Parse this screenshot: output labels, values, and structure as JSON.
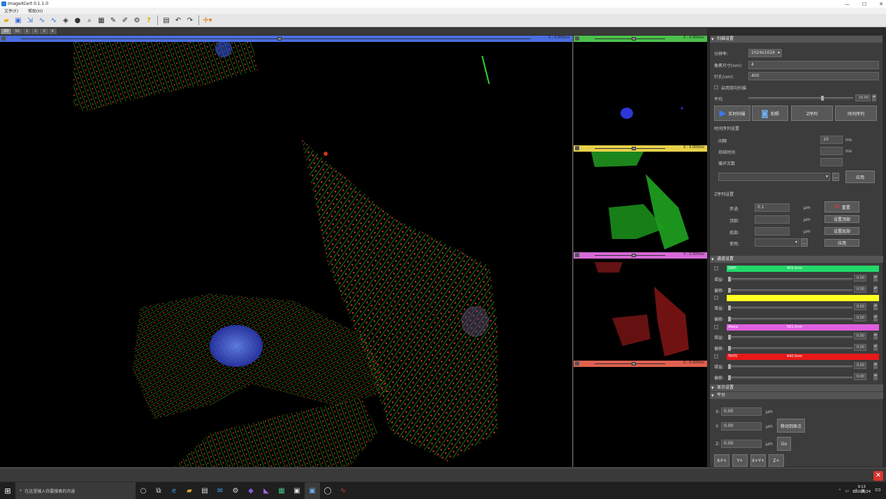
{
  "window": {
    "title": "ImageXCert 0.1.1.0",
    "minimize": "—",
    "maximize": "☐",
    "close": "✕"
  },
  "menu": [
    "文件(F)",
    "帮助(H)"
  ],
  "toolbar_icons": [
    "open-folder-icon",
    "save-icon",
    "export-icon",
    "waveform-icon",
    "waveform2-icon",
    "cube-icon",
    "sphere-icon",
    "zoom-icon",
    "map-icon",
    "pin-icon",
    "edit-icon",
    "settings-icon",
    "help-icon",
    "window-icon",
    "undo-icon",
    "redo-icon",
    "crosshair-icon"
  ],
  "view_tabs": [
    "2D",
    "3D",
    "1",
    "2",
    "3",
    "4"
  ],
  "channels": [
    {
      "color": "#4a6ee0",
      "label": "0 : 0.000ms"
    },
    {
      "color": "#4cc24c",
      "label": "0 : 0.000ms"
    },
    {
      "color": "#e8d24a",
      "label": "0 : 0.000ms"
    },
    {
      "color": "#d86ad8",
      "label": "0 : 0.000ms"
    },
    {
      "color": "#e06050",
      "label": "0 : 0.000ms"
    }
  ],
  "scan": {
    "header": "扫描设置",
    "resolution_label": "分辨率:",
    "resolution_value": "1024x1024",
    "pixel_size_label": "像素尺寸(nm):",
    "pixel_size_value": "4",
    "dwell_label": "针孔(nm):",
    "dwell_value": "400",
    "bidirectional_label": "启用双向扫描",
    "average_label": "平均",
    "average_value": "10.00",
    "btn_live": "实时扫描",
    "btn_capture": "拍照",
    "btn_sequence": "Z序列",
    "btn_time": "时间序列",
    "timelapse_header": "时间序列设置",
    "interval_label": "间隔",
    "interval_value": "10",
    "interval_unit": "ms",
    "duration_label": "持续时间",
    "duration_unit": "ms",
    "count_label": "循环次数",
    "apply_btn": "应用",
    "z_header": "Z序列设置",
    "step_label": "步进:",
    "step_value": "0.1",
    "start_label": "顶部:",
    "end_label": "底部:",
    "use_label": "使用:",
    "unit_um": "µm",
    "btn_reset": "重置",
    "btn_set_top": "设置顶部",
    "btn_set_bottom": "设置底部",
    "btn_apply2": "应用"
  },
  "channel_panel": {
    "header": "通道设置",
    "items": [
      {
        "name": "DAPI",
        "wavelength": "405.0nm",
        "color": "#22d86a",
        "gain": "0.00",
        "offset": "0.00"
      },
      {
        "name": "",
        "wavelength": "",
        "color": "#ffff22",
        "gain": "0.00",
        "offset": "0.00"
      },
      {
        "name": "Alexa",
        "wavelength": "561.0nm",
        "color": "#e060e0",
        "gain": "0.00",
        "offset": "0.00"
      },
      {
        "name": "TRITC",
        "wavelength": "640.0nm",
        "color": "#e81818",
        "gain": "0.00",
        "offset": "0.00"
      }
    ],
    "gain_label": "增益:",
    "offset_label": "偏移:"
  },
  "display_header": "显示设置",
  "stage": {
    "header": "平台",
    "x_label": "X:",
    "x_value": "0.00",
    "y_label": "Y:",
    "y_value": "0.00",
    "z_label": "Z:",
    "z_value": "0.00",
    "unit": "µm",
    "btn_center": "移动到原点",
    "btn_go": "Go",
    "btns": [
      "X-Y+",
      "Y+",
      "X+Y+",
      "Z+"
    ]
  },
  "taskbar": {
    "search_placeholder": "在这里输入你要搜索的内容",
    "time": "9:13",
    "date": "2020/6/24"
  }
}
